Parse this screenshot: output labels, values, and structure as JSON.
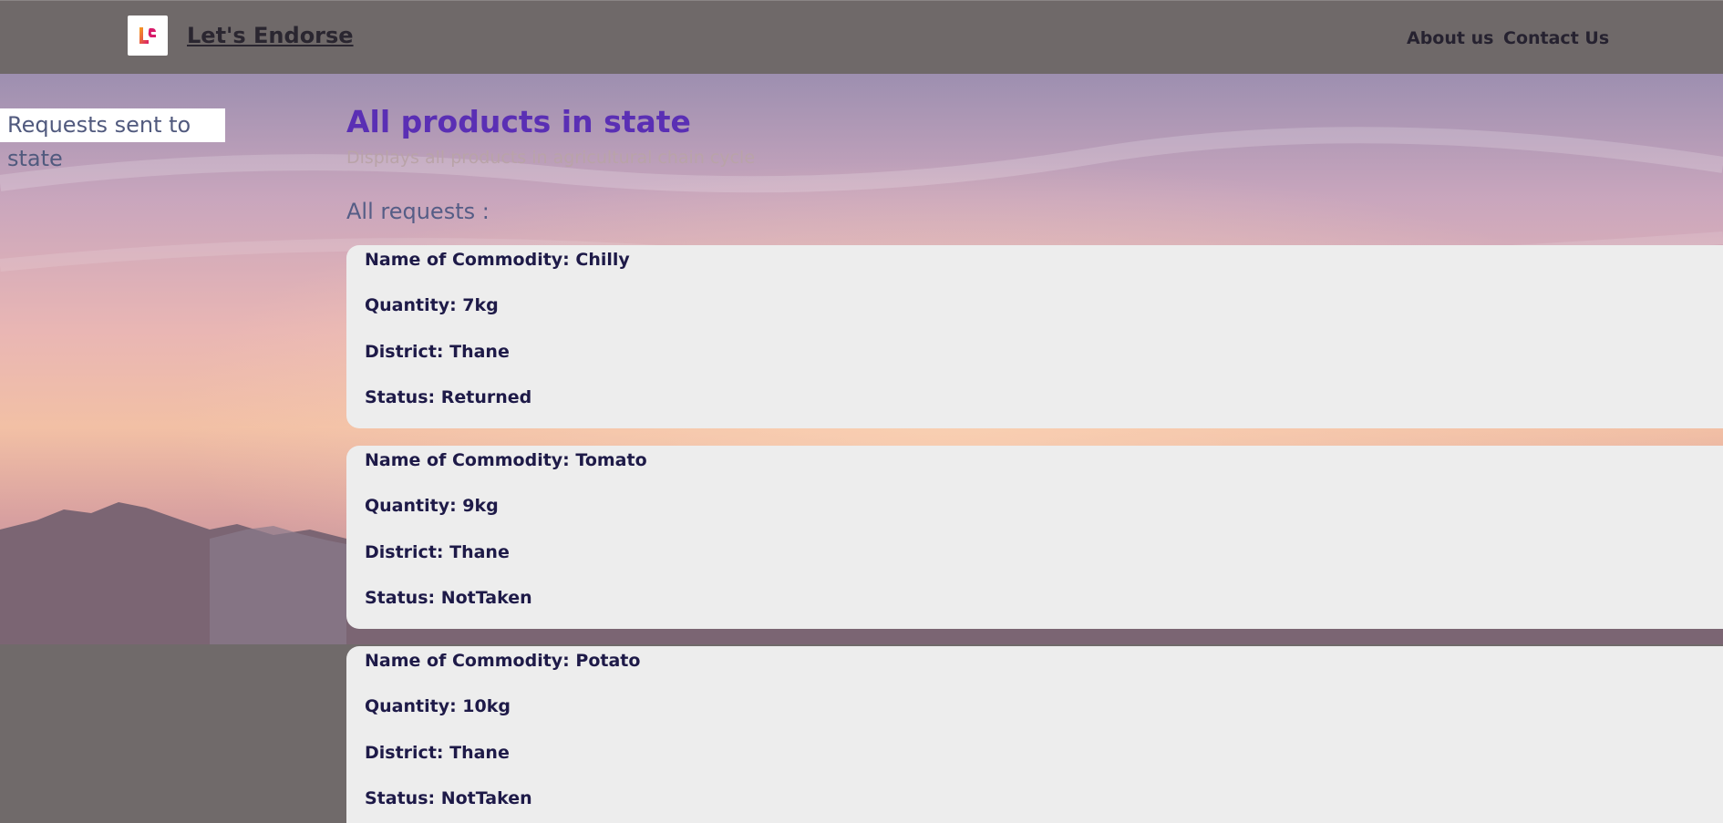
{
  "header": {
    "brand": "Let's Endorse",
    "logo_text": "LE",
    "nav": [
      "About us",
      "Contact Us"
    ]
  },
  "sidebar": {
    "items": [
      {
        "label": "Requests sent to state"
      }
    ]
  },
  "main": {
    "title": "All products in state",
    "subtitle": "Displays all products in agricultural chain cycle",
    "section_heading": "All requests :",
    "requests": [
      {
        "commodity": "Name of Commodity: Chilly",
        "quantity": "Quantity: 7kg",
        "district": "District: Thane",
        "status": "Status: Returned"
      },
      {
        "commodity": "Name of Commodity: Tomato",
        "quantity": "Quantity: 9kg",
        "district": "District: Thane",
        "status": "Status: NotTaken"
      },
      {
        "commodity": "Name of Commodity: Potato",
        "quantity": "Quantity: 10kg",
        "district": "District: Thane",
        "status": "Status: NotTaken"
      }
    ]
  },
  "colors": {
    "header_bg": "#6f6969",
    "title": "#5a2fb4",
    "card_bg": "#ededed",
    "card_text": "#1e1a48",
    "sidebar_text": "#515a7e"
  }
}
